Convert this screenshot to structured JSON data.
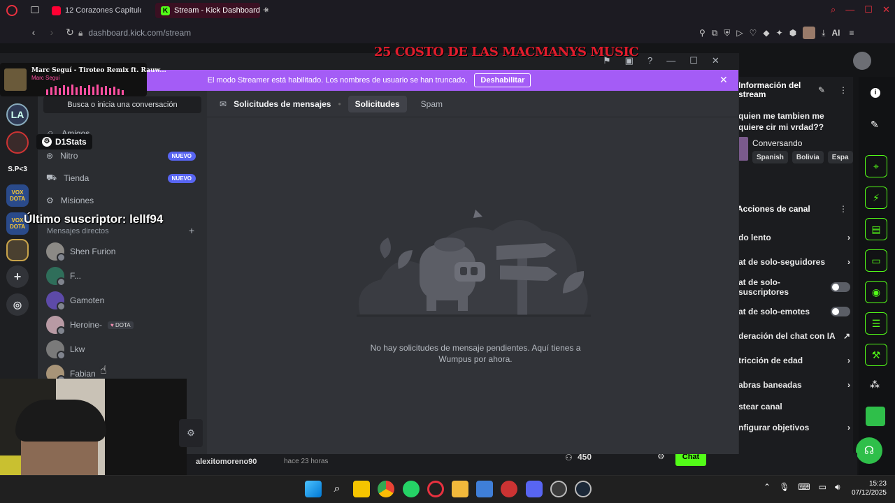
{
  "browser": {
    "tabs": [
      {
        "label": "12 Corazones Capítulo Co",
        "color": "#ff0033"
      },
      {
        "label": "Stream - Kick Dashboard",
        "color": "#53fc18"
      }
    ],
    "url_domain": "dashboard.kick.com",
    "url_path": "/stream",
    "ai_label": "AI"
  },
  "overlays": {
    "stream_title": "25 COSTO DE LAS MACMANYS MUSIC",
    "latest_sub": "Último suscriptor: lellf94",
    "now_playing_title": "Marc Seguí - Tiroteo Remix ft. Rauw...",
    "now_playing_artist": "Marc Seguí"
  },
  "discord": {
    "banner_text": "El modo Streamer está habilitado. Los nombres de usuario se han truncado.",
    "banner_button": "Deshabilitar",
    "search_placeholder": "Busca o inicia una conversación",
    "tooltip": "D1Stats",
    "nav": [
      {
        "label": "Amigos",
        "badge": ""
      },
      {
        "label": "Nitro",
        "badge": "NUEVO"
      },
      {
        "label": "Tienda",
        "badge": "NUEVO"
      },
      {
        "label": "Misiones",
        "badge": ""
      }
    ],
    "dm_header": "Mensajes directos",
    "dms": [
      {
        "name": "Shen Furion",
        "tag": ""
      },
      {
        "name": "F...",
        "tag": ""
      },
      {
        "name": "Gamoten",
        "tag": ""
      },
      {
        "name": "Heroine-",
        "tag": "DOTA"
      },
      {
        "name": "Lkw",
        "tag": ""
      },
      {
        "name": "Fabian",
        "tag": ""
      }
    ],
    "servers": [
      "S.P<3",
      "VOX DOTA",
      "VOX DOTA"
    ],
    "main": {
      "header": "Solicitudes de mensajes",
      "tab_active": "Solicitudes",
      "tab_other": "Spam",
      "empty_text": "No hay solicitudes de mensaje pendientes. Aquí tienes a Wumpus por ahora."
    }
  },
  "kick": {
    "info_title": "Información del stream",
    "stream_desc": "quien me tambien me quiere cir mi vrdad??",
    "category": "Conversando",
    "tags": [
      "Spanish",
      "Bolivia",
      "Espa"
    ],
    "actions_title": "Acciones de canal",
    "actions": [
      {
        "label": "do lento",
        "control": "arrow"
      },
      {
        "label": "at de solo-seguidores",
        "control": "arrow"
      },
      {
        "label": "at de solo-suscriptores",
        "control": "toggle"
      },
      {
        "label": "at de solo-emotes",
        "control": "toggle"
      },
      {
        "label": "deración del chat con IA",
        "control": "link"
      },
      {
        "label": "tricción de edad",
        "control": "arrow"
      },
      {
        "label": "abras baneadas",
        "control": "arrow"
      },
      {
        "label": "stear canal",
        "control": "none"
      },
      {
        "label": "nfigurar objetivos",
        "control": "arrow"
      }
    ],
    "bottom": {
      "user": "alexitomoreno90",
      "time": "hace 23 horas",
      "viewers": "450",
      "chat_button": "Chat"
    }
  },
  "taskbar": {
    "time": "15:23",
    "date": "07/12/2025"
  }
}
